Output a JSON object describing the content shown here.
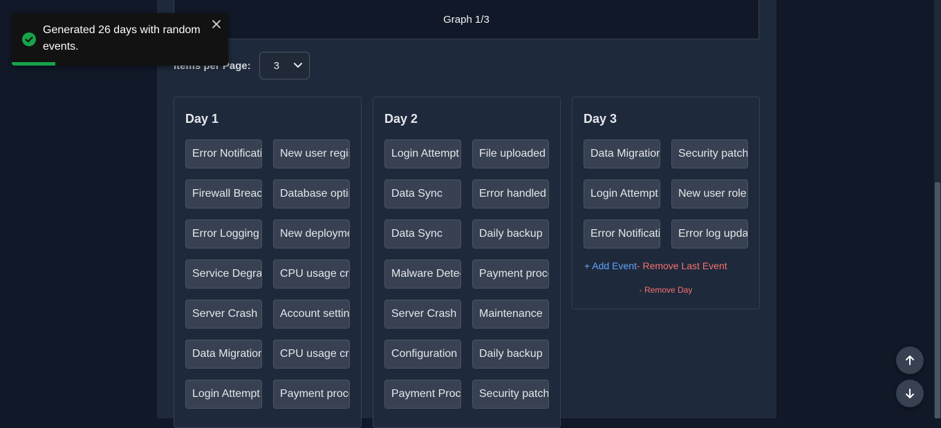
{
  "graph": {
    "title": "Graph 1/3"
  },
  "pagination": {
    "label": "Items per Page:",
    "value": "3"
  },
  "toast": {
    "message": "Generated 26 days with random events.",
    "progress": 0.2
  },
  "days": [
    {
      "title": "Day 1",
      "events": [
        "Error Notification",
        "New user registered",
        "Firewall Breach",
        "Database optimization",
        "Error Logging",
        "New deployment",
        "Service Degradation",
        "CPU usage critical",
        "Server Crash",
        "Account settings updated",
        "Data Migration",
        "CPU usage critical",
        "Login Attempt",
        "Payment processed"
      ]
    },
    {
      "title": "Day 2",
      "events": [
        "Login Attempt",
        "File uploaded",
        "Data Sync",
        "Error handled",
        "Data Sync",
        "Daily backup",
        "Malware Detected",
        "Payment processed",
        "Server Crash",
        "Maintenance",
        "Configuration",
        "Daily backup",
        "Payment Processing",
        "Security patch"
      ]
    },
    {
      "title": "Day 3",
      "events": [
        "Data Migration",
        "Security patch",
        "Login Attempt",
        "New user role",
        "Error Notification",
        "Error log updated"
      ],
      "add_event": "+ Add Event",
      "remove_last": "- Remove Last Event",
      "remove_day": "- Remove Day"
    }
  ],
  "colors": {
    "accent_blue": "#60a5fa",
    "danger_red": "#f87171",
    "success_green": "#16a34a"
  }
}
